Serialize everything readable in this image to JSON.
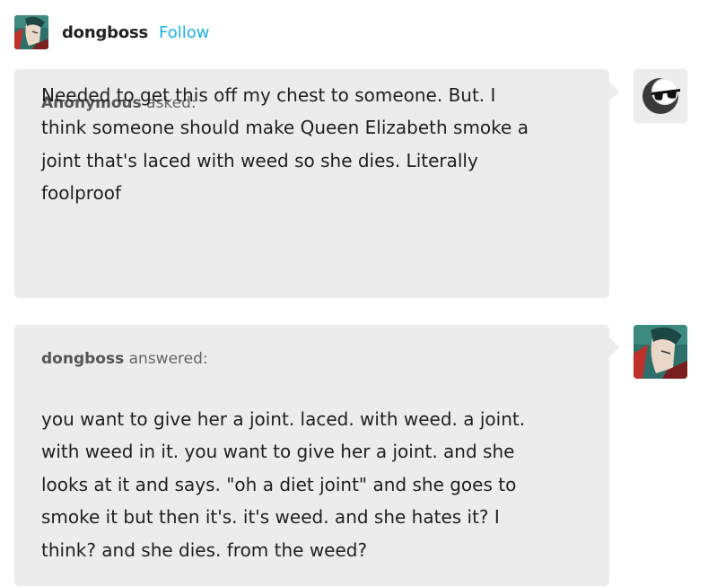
{
  "header": {
    "blog_name": "dongboss",
    "follow_label": "Follow",
    "avatar_icon": "blog-avatar-icon"
  },
  "question": {
    "asker_name": "Anonymous",
    "asker_verb": "asked:",
    "lines": [
      "Needed to get this off my chest to someone. But. I",
      "think someone should make Queen Elizabeth smoke a",
      "joint that's laced with weed so she dies. Literally",
      "foolproof"
    ],
    "avatar_icon": "anonymous-sunglasses-icon"
  },
  "answer": {
    "answerer_name": "dongboss",
    "answerer_verb": "answered:",
    "lines": [
      "you want to give her a joint. laced. with weed. a joint.",
      "with weed in it. you want to give her a joint. and she",
      "looks at it and says. \"oh a diet joint\" and she goes to",
      "smoke it but then it's. it's weed. and she hates it? I",
      "think? and she dies. from the weed?"
    ],
    "avatar_icon": "blog-avatar-icon"
  },
  "colors": {
    "bubble_bg": "#ececec",
    "follow": "#1bb0ea",
    "text": "#1f1f1f"
  }
}
